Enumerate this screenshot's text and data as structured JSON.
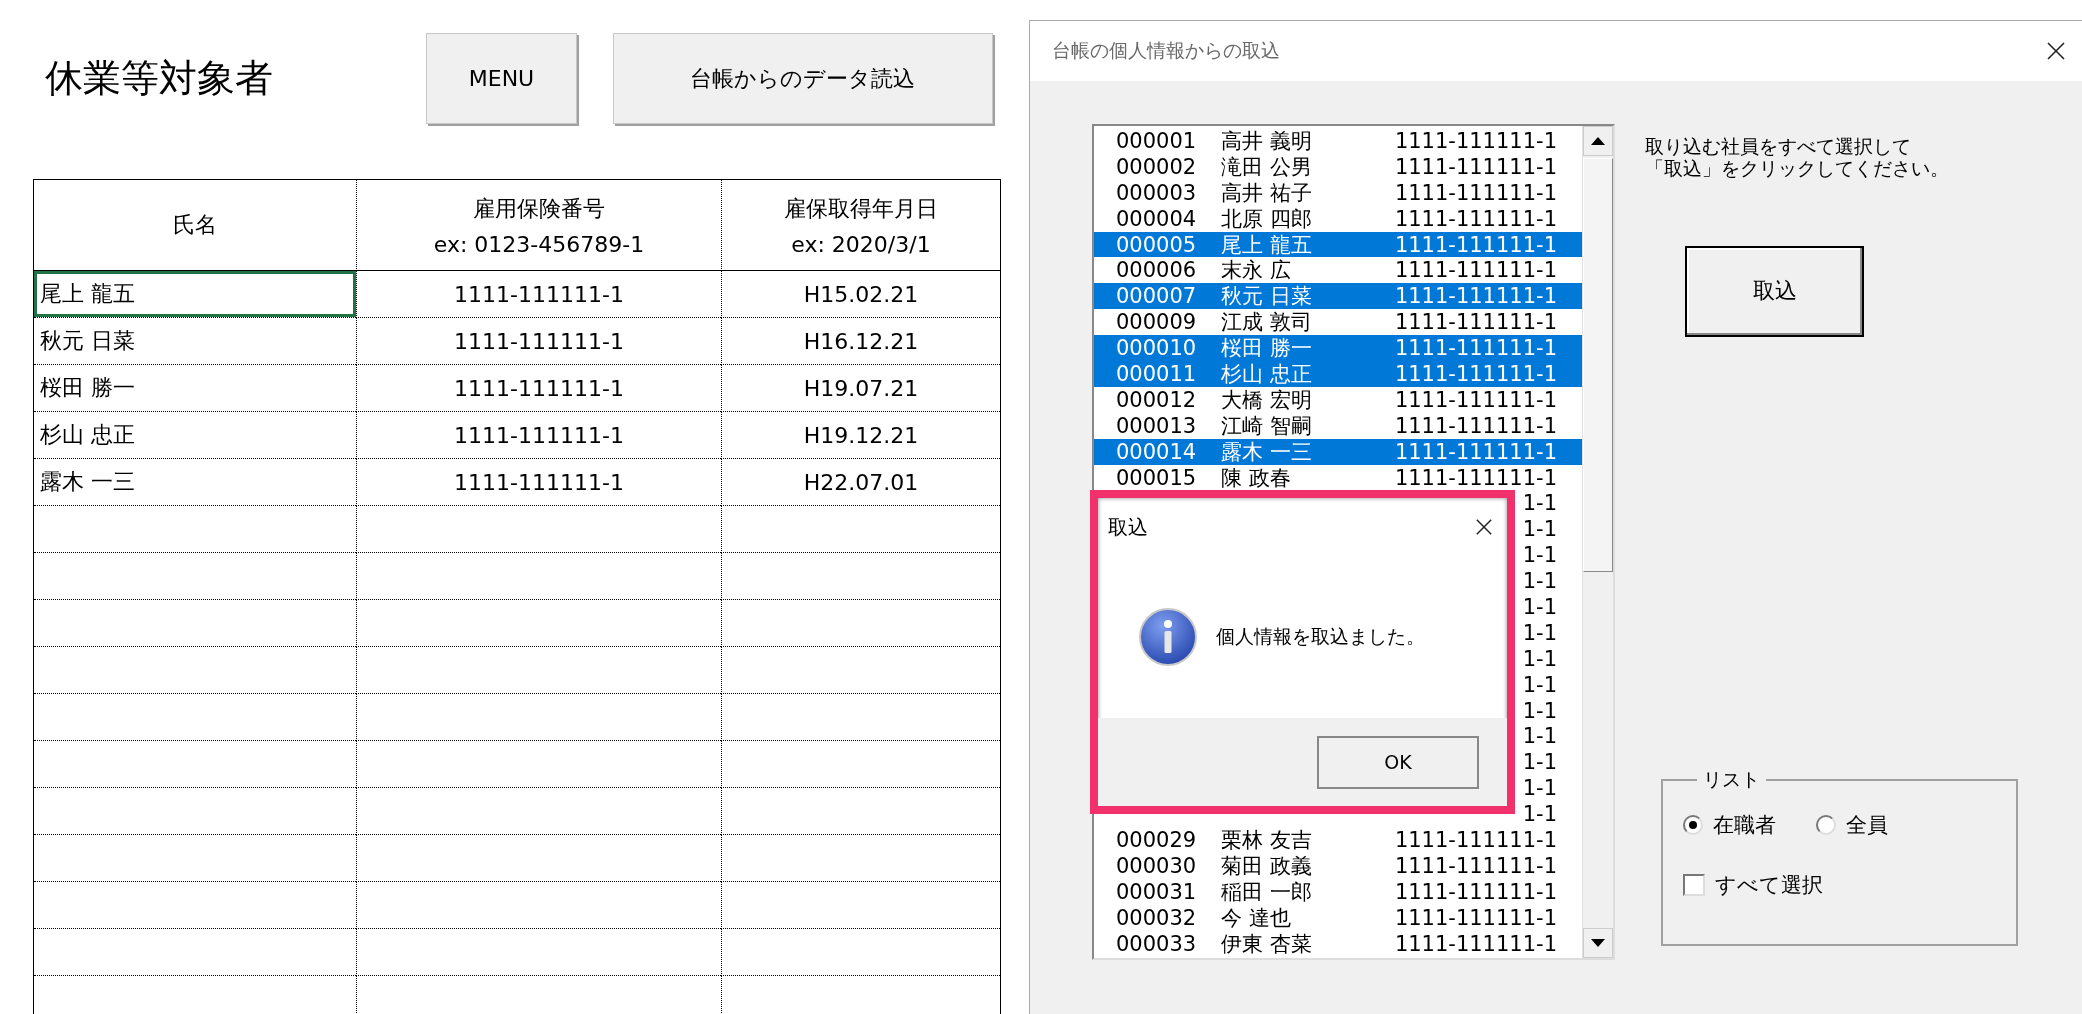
{
  "sheet": {
    "title": "休業等対象者",
    "buttons": [
      "MENU",
      "台帳からのデータ読込"
    ],
    "table": {
      "columns": [
        {
          "label": "氏名"
        },
        {
          "label": "雇用保険番号",
          "hint": "ex: 0123-456789-1"
        },
        {
          "label": "雇保取得年月日",
          "hint": "ex: 2020/3/1"
        }
      ],
      "rows": [
        {
          "cells": [
            "尾上 龍五",
            "1111-111111-1",
            "H15.02.21"
          ],
          "selected": true
        },
        {
          "cells": [
            "秋元 日菜",
            "1111-111111-1",
            "H16.12.21"
          ],
          "selected": false
        },
        {
          "cells": [
            "桜田 勝一",
            "1111-111111-1",
            "H19.07.21"
          ],
          "selected": false
        },
        {
          "cells": [
            "杉山 忠正",
            "1111-111111-1",
            "H19.12.21"
          ],
          "selected": false
        },
        {
          "cells": [
            "露木 一三",
            "1111-111111-1",
            "H22.07.01"
          ],
          "selected": false
        }
      ]
    }
  },
  "dialog": {
    "title": "台帳の個人情報からの取込",
    "employees": [
      {
        "number": "000001",
        "name": "高井 義明",
        "insurance_no": "1111-111111-1",
        "selected": false
      },
      {
        "number": "000002",
        "name": "滝田 公男",
        "insurance_no": "1111-111111-1",
        "selected": false
      },
      {
        "number": "000003",
        "name": "高井 祐子",
        "insurance_no": "1111-111111-1",
        "selected": false
      },
      {
        "number": "000004",
        "name": "北原 四郎",
        "insurance_no": "1111-111111-1",
        "selected": false
      },
      {
        "number": "000005",
        "name": "尾上 龍五",
        "insurance_no": "1111-111111-1",
        "selected": true
      },
      {
        "number": "000006",
        "name": "末永 広",
        "insurance_no": "1111-111111-1",
        "selected": false
      },
      {
        "number": "000007",
        "name": "秋元 日菜",
        "insurance_no": "1111-111111-1",
        "selected": true
      },
      {
        "number": "000009",
        "name": "江成 敦司",
        "insurance_no": "1111-111111-1",
        "selected": false
      },
      {
        "number": "000010",
        "name": "桜田 勝一",
        "insurance_no": "1111-111111-1",
        "selected": true
      },
      {
        "number": "000011",
        "name": "杉山 忠正",
        "insurance_no": "1111-111111-1",
        "selected": true
      },
      {
        "number": "000012",
        "name": "大橋 宏明",
        "insurance_no": "1111-111111-1",
        "selected": false
      },
      {
        "number": "000013",
        "name": "江崎 智嗣",
        "insurance_no": "1111-111111-1",
        "selected": false
      },
      {
        "number": "000014",
        "name": "露木 一三",
        "insurance_no": "1111-111111-1",
        "selected": true
      },
      {
        "number": "000015",
        "name": "陳 政春",
        "insurance_no": "1111-111111-1",
        "selected": false
      },
      {
        "insurance_no": "1-1",
        "selected": false
      },
      {
        "insurance_no": "1-1",
        "selected": false
      },
      {
        "insurance_no": "1-1",
        "selected": false
      },
      {
        "insurance_no": "1-1",
        "selected": false
      },
      {
        "insurance_no": "1-1",
        "selected": false
      },
      {
        "insurance_no": "1-1",
        "selected": false
      },
      {
        "insurance_no": "1-1",
        "selected": false
      },
      {
        "insurance_no": "1-1",
        "selected": false
      },
      {
        "insurance_no": "1-1",
        "selected": false
      },
      {
        "insurance_no": "1-1",
        "selected": false
      },
      {
        "insurance_no": "1-1",
        "selected": false
      },
      {
        "insurance_no": "1-1",
        "selected": false
      },
      {
        "insurance_no": "1-1",
        "selected": false
      },
      {
        "number": "000029",
        "name": "栗林 友吉",
        "insurance_no": "1111-111111-1",
        "selected": false
      },
      {
        "number": "000030",
        "name": "菊田 政義",
        "insurance_no": "1111-111111-1",
        "selected": false
      },
      {
        "number": "000031",
        "name": "稲田 一郎",
        "insurance_no": "1111-111111-1",
        "selected": false
      },
      {
        "number": "000032",
        "name": "今 達也",
        "insurance_no": "1111-111111-1",
        "selected": false
      },
      {
        "number": "000033",
        "name": "伊東 杏菜",
        "insurance_no": "1111-111111-1",
        "selected": false
      }
    ],
    "instruction": [
      "取り込む社員をすべて選択して",
      "「取込」をクリックしてください。"
    ],
    "import_button": "取込",
    "list_group": {
      "label": "リスト",
      "options": [
        {
          "label": "在職者",
          "selected": true
        },
        {
          "label": "全員",
          "selected": false
        }
      ],
      "select_all": {
        "label": "すべて選択",
        "checked": false
      }
    }
  },
  "message_box": {
    "title": "取込",
    "message": "個人情報を取込ました。",
    "button": "OK"
  }
}
